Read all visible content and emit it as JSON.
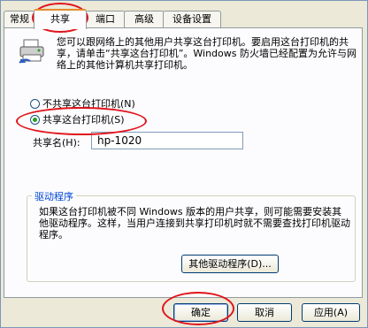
{
  "tabs": [
    {
      "label": "常规"
    },
    {
      "label": "共享"
    },
    {
      "label": "端口"
    },
    {
      "label": "高级"
    },
    {
      "label": "设备设置"
    }
  ],
  "intro_text": "您可以跟网络上的其他用户共享这台打印机。要启用这台打印机的共享，请单击“共享这台打印机”。Windows 防火墙已经配置为允许与网络上的其他计算机共享打印机。",
  "sharing": {
    "no_share_label": "不共享这台打印机(N)",
    "share_label": "共享这台打印机(S)",
    "selected": "share",
    "share_name_label": "共享名(H):",
    "share_name_value": "hp-1020"
  },
  "drivers": {
    "title": "驱动程序",
    "text": "如果这台打印机被不同 Windows 版本的用户共享，则可能需要安装其他驱动程序。这样，当用户连接到共享打印机时就不需要查找打印机驱动程序。",
    "button_label": "其他驱动程序(D)..."
  },
  "footer": {
    "ok_label": "确定",
    "cancel_label": "取消",
    "apply_label": "应用(A)"
  },
  "colors": {
    "annotation": "#e0141b",
    "dialog_bg": "#ece9d8",
    "tab_highlight": "#e68b2c"
  }
}
